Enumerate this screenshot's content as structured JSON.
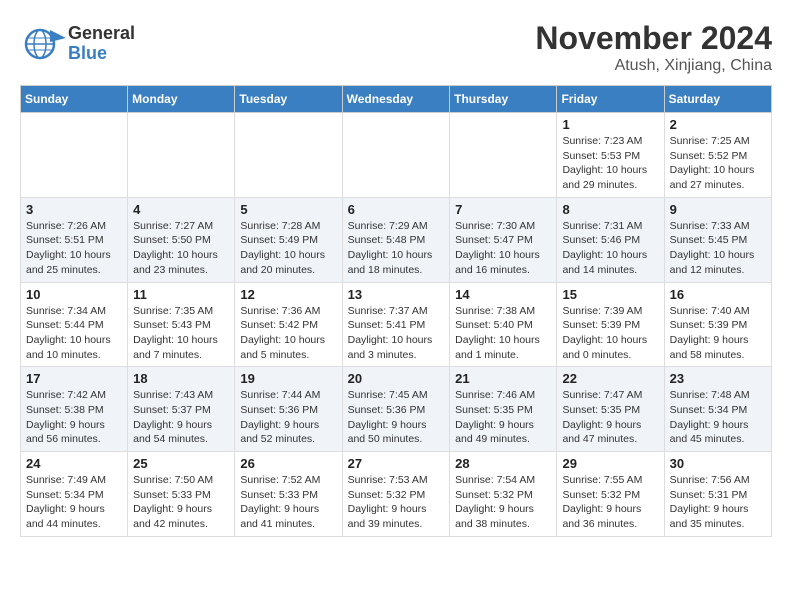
{
  "logo": {
    "general": "General",
    "blue": "Blue"
  },
  "header": {
    "month": "November 2024",
    "location": "Atush, Xinjiang, China"
  },
  "days_of_week": [
    "Sunday",
    "Monday",
    "Tuesday",
    "Wednesday",
    "Thursday",
    "Friday",
    "Saturday"
  ],
  "weeks": [
    [
      {
        "day": "",
        "info": ""
      },
      {
        "day": "",
        "info": ""
      },
      {
        "day": "",
        "info": ""
      },
      {
        "day": "",
        "info": ""
      },
      {
        "day": "",
        "info": ""
      },
      {
        "day": "1",
        "info": "Sunrise: 7:23 AM\nSunset: 5:53 PM\nDaylight: 10 hours and 29 minutes."
      },
      {
        "day": "2",
        "info": "Sunrise: 7:25 AM\nSunset: 5:52 PM\nDaylight: 10 hours and 27 minutes."
      }
    ],
    [
      {
        "day": "3",
        "info": "Sunrise: 7:26 AM\nSunset: 5:51 PM\nDaylight: 10 hours and 25 minutes."
      },
      {
        "day": "4",
        "info": "Sunrise: 7:27 AM\nSunset: 5:50 PM\nDaylight: 10 hours and 23 minutes."
      },
      {
        "day": "5",
        "info": "Sunrise: 7:28 AM\nSunset: 5:49 PM\nDaylight: 10 hours and 20 minutes."
      },
      {
        "day": "6",
        "info": "Sunrise: 7:29 AM\nSunset: 5:48 PM\nDaylight: 10 hours and 18 minutes."
      },
      {
        "day": "7",
        "info": "Sunrise: 7:30 AM\nSunset: 5:47 PM\nDaylight: 10 hours and 16 minutes."
      },
      {
        "day": "8",
        "info": "Sunrise: 7:31 AM\nSunset: 5:46 PM\nDaylight: 10 hours and 14 minutes."
      },
      {
        "day": "9",
        "info": "Sunrise: 7:33 AM\nSunset: 5:45 PM\nDaylight: 10 hours and 12 minutes."
      }
    ],
    [
      {
        "day": "10",
        "info": "Sunrise: 7:34 AM\nSunset: 5:44 PM\nDaylight: 10 hours and 10 minutes."
      },
      {
        "day": "11",
        "info": "Sunrise: 7:35 AM\nSunset: 5:43 PM\nDaylight: 10 hours and 7 minutes."
      },
      {
        "day": "12",
        "info": "Sunrise: 7:36 AM\nSunset: 5:42 PM\nDaylight: 10 hours and 5 minutes."
      },
      {
        "day": "13",
        "info": "Sunrise: 7:37 AM\nSunset: 5:41 PM\nDaylight: 10 hours and 3 minutes."
      },
      {
        "day": "14",
        "info": "Sunrise: 7:38 AM\nSunset: 5:40 PM\nDaylight: 10 hours and 1 minute."
      },
      {
        "day": "15",
        "info": "Sunrise: 7:39 AM\nSunset: 5:39 PM\nDaylight: 10 hours and 0 minutes."
      },
      {
        "day": "16",
        "info": "Sunrise: 7:40 AM\nSunset: 5:39 PM\nDaylight: 9 hours and 58 minutes."
      }
    ],
    [
      {
        "day": "17",
        "info": "Sunrise: 7:42 AM\nSunset: 5:38 PM\nDaylight: 9 hours and 56 minutes."
      },
      {
        "day": "18",
        "info": "Sunrise: 7:43 AM\nSunset: 5:37 PM\nDaylight: 9 hours and 54 minutes."
      },
      {
        "day": "19",
        "info": "Sunrise: 7:44 AM\nSunset: 5:36 PM\nDaylight: 9 hours and 52 minutes."
      },
      {
        "day": "20",
        "info": "Sunrise: 7:45 AM\nSunset: 5:36 PM\nDaylight: 9 hours and 50 minutes."
      },
      {
        "day": "21",
        "info": "Sunrise: 7:46 AM\nSunset: 5:35 PM\nDaylight: 9 hours and 49 minutes."
      },
      {
        "day": "22",
        "info": "Sunrise: 7:47 AM\nSunset: 5:35 PM\nDaylight: 9 hours and 47 minutes."
      },
      {
        "day": "23",
        "info": "Sunrise: 7:48 AM\nSunset: 5:34 PM\nDaylight: 9 hours and 45 minutes."
      }
    ],
    [
      {
        "day": "24",
        "info": "Sunrise: 7:49 AM\nSunset: 5:34 PM\nDaylight: 9 hours and 44 minutes."
      },
      {
        "day": "25",
        "info": "Sunrise: 7:50 AM\nSunset: 5:33 PM\nDaylight: 9 hours and 42 minutes."
      },
      {
        "day": "26",
        "info": "Sunrise: 7:52 AM\nSunset: 5:33 PM\nDaylight: 9 hours and 41 minutes."
      },
      {
        "day": "27",
        "info": "Sunrise: 7:53 AM\nSunset: 5:32 PM\nDaylight: 9 hours and 39 minutes."
      },
      {
        "day": "28",
        "info": "Sunrise: 7:54 AM\nSunset: 5:32 PM\nDaylight: 9 hours and 38 minutes."
      },
      {
        "day": "29",
        "info": "Sunrise: 7:55 AM\nSunset: 5:32 PM\nDaylight: 9 hours and 36 minutes."
      },
      {
        "day": "30",
        "info": "Sunrise: 7:56 AM\nSunset: 5:31 PM\nDaylight: 9 hours and 35 minutes."
      }
    ]
  ]
}
